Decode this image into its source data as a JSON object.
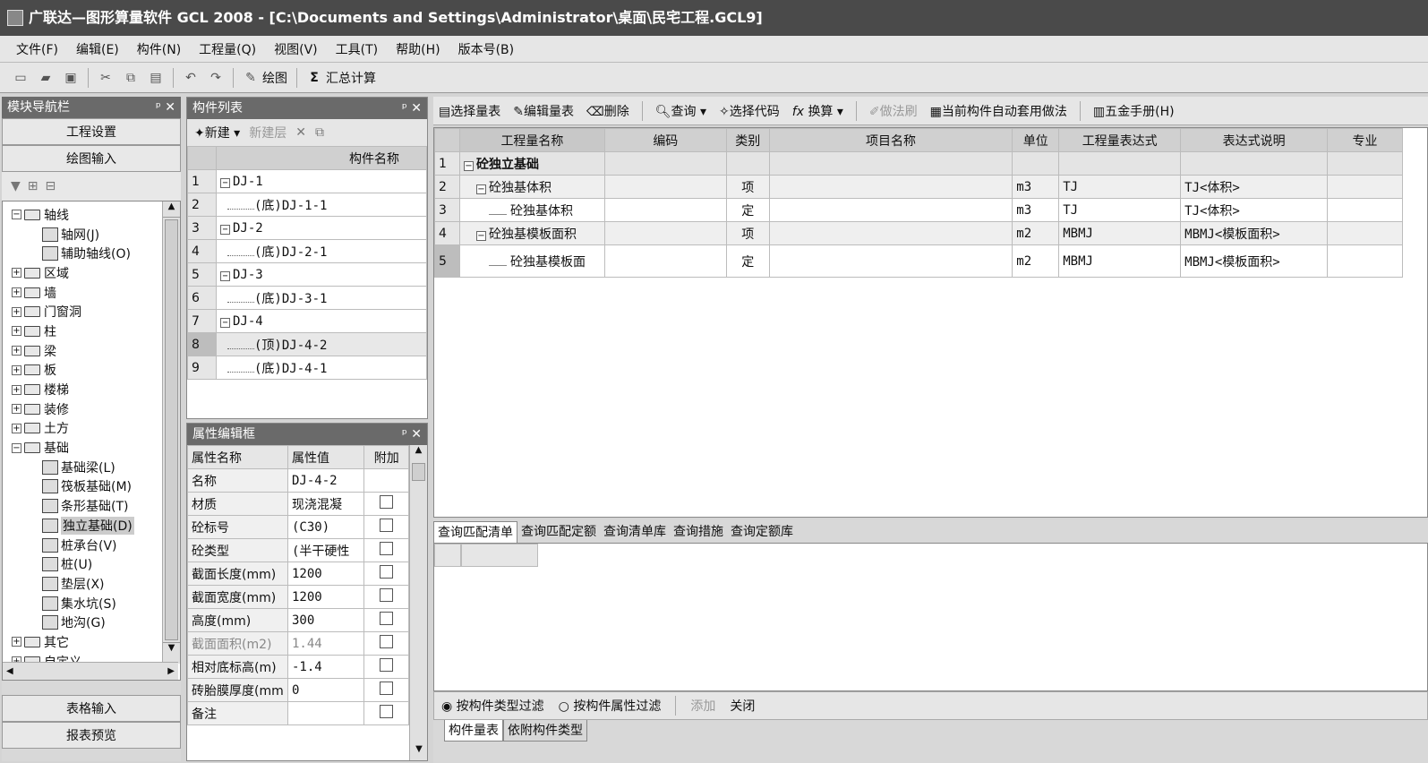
{
  "window": {
    "title": "广联达—图形算量软件 GCL 2008 - [C:\\Documents and Settings\\Administrator\\桌面\\民宅工程.GCL9]"
  },
  "menu": [
    "文件(F)",
    "编辑(E)",
    "构件(N)",
    "工程量(Q)",
    "视图(V)",
    "工具(T)",
    "帮助(H)",
    "版本号(B)"
  ],
  "toolbar": {
    "draw": "绘图",
    "sum": "汇总计算"
  },
  "nav": {
    "title": "模块导航栏",
    "btn_project": "工程设置",
    "btn_draw": "绘图输入",
    "btn_table": "表格输入",
    "btn_report": "报表预览",
    "tree": [
      {
        "label": "轴线",
        "level": 0,
        "exp": "−",
        "icon": "folder-open"
      },
      {
        "label": "轴网(J)",
        "level": 1,
        "icon": "grid"
      },
      {
        "label": "辅助轴线(O)",
        "level": 1,
        "icon": "axis"
      },
      {
        "label": "区域",
        "level": 0,
        "exp": "+",
        "icon": "folder"
      },
      {
        "label": "墙",
        "level": 0,
        "exp": "+",
        "icon": "folder"
      },
      {
        "label": "门窗洞",
        "level": 0,
        "exp": "+",
        "icon": "folder"
      },
      {
        "label": "柱",
        "level": 0,
        "exp": "+",
        "icon": "folder"
      },
      {
        "label": "梁",
        "level": 0,
        "exp": "+",
        "icon": "folder"
      },
      {
        "label": "板",
        "level": 0,
        "exp": "+",
        "icon": "folder"
      },
      {
        "label": "楼梯",
        "level": 0,
        "exp": "+",
        "icon": "folder"
      },
      {
        "label": "装修",
        "level": 0,
        "exp": "+",
        "icon": "folder"
      },
      {
        "label": "土方",
        "level": 0,
        "exp": "+",
        "icon": "folder"
      },
      {
        "label": "基础",
        "level": 0,
        "exp": "−",
        "icon": "folder-open"
      },
      {
        "label": "基础梁(L)",
        "level": 1,
        "icon": "beam"
      },
      {
        "label": "筏板基础(M)",
        "level": 1,
        "icon": "raft"
      },
      {
        "label": "条形基础(T)",
        "level": 1,
        "icon": "strip"
      },
      {
        "label": "独立基础(D)",
        "level": 1,
        "icon": "isolated",
        "selected": true
      },
      {
        "label": "桩承台(V)",
        "level": 1,
        "icon": "cap"
      },
      {
        "label": "桩(U)",
        "level": 1,
        "icon": "pile"
      },
      {
        "label": "垫层(X)",
        "level": 1,
        "icon": "cushion"
      },
      {
        "label": "集水坑(S)",
        "level": 1,
        "icon": "sump"
      },
      {
        "label": "地沟(G)",
        "level": 1,
        "icon": "trench"
      },
      {
        "label": "其它",
        "level": 0,
        "exp": "+",
        "icon": "folder"
      },
      {
        "label": "自定义",
        "level": 0,
        "exp": "+",
        "icon": "folder"
      }
    ]
  },
  "components": {
    "title": "构件列表",
    "new": "新建",
    "new_layer": "新建层",
    "col": "构件名称",
    "rows": [
      {
        "n": "1",
        "name": "DJ-1",
        "root": true
      },
      {
        "n": "2",
        "name": "(底)DJ-1-1"
      },
      {
        "n": "3",
        "name": "DJ-2",
        "root": true
      },
      {
        "n": "4",
        "name": "(底)DJ-2-1"
      },
      {
        "n": "5",
        "name": "DJ-3",
        "root": true
      },
      {
        "n": "6",
        "name": "(底)DJ-3-1"
      },
      {
        "n": "7",
        "name": "DJ-4",
        "root": true
      },
      {
        "n": "8",
        "name": "(顶)DJ-4-2",
        "selected": true
      },
      {
        "n": "9",
        "name": "(底)DJ-4-1"
      }
    ]
  },
  "props": {
    "title": "属性编辑框",
    "cols": [
      "属性名称",
      "属性值",
      "附加"
    ],
    "rows": [
      {
        "name": "名称",
        "value": "DJ-4-2",
        "chk": false
      },
      {
        "name": "材质",
        "value": "现浇混凝",
        "chk": true
      },
      {
        "name": "砼标号",
        "value": "(C30)",
        "chk": true
      },
      {
        "name": "砼类型",
        "value": "(半干硬性",
        "chk": true
      },
      {
        "name": "截面长度(mm)",
        "value": "1200",
        "chk": true
      },
      {
        "name": "截面宽度(mm)",
        "value": "1200",
        "chk": true
      },
      {
        "name": "高度(mm)",
        "value": "300",
        "chk": true
      },
      {
        "name": "截面面积(m2)",
        "value": "1.44",
        "chk": true,
        "dim": true
      },
      {
        "name": "相对底标高(m)",
        "value": "-1.4",
        "chk": true
      },
      {
        "name": "砖胎膜厚度(mm",
        "value": "0",
        "chk": true
      },
      {
        "name": "备注",
        "value": "",
        "chk": true
      }
    ]
  },
  "qtoolbar": {
    "select": "选择量表",
    "edit": "编辑量表",
    "delete": "删除",
    "query": "查询",
    "select_code": "选择代码",
    "convert": "换算",
    "method": "做法刷",
    "auto": "当前构件自动套用做法",
    "manual": "五金手册(H)"
  },
  "qtable": {
    "cols": [
      "工程量名称",
      "编码",
      "类别",
      "项目名称",
      "单位",
      "工程量表达式",
      "表达式说明",
      "专业"
    ],
    "rows": [
      {
        "n": "1",
        "name": "砼独立基础",
        "code": "",
        "type": "",
        "proj": "",
        "unit": "",
        "expr": "",
        "desc": "",
        "spec": "",
        "level": 0,
        "bold": true
      },
      {
        "n": "2",
        "name": "砼独基体积",
        "code": "",
        "type": "项",
        "proj": "",
        "unit": "m3",
        "expr": "TJ",
        "desc": "TJ<体积>",
        "spec": "",
        "level": 1
      },
      {
        "n": "3",
        "name": "砼独基体积",
        "code": "",
        "type": "定",
        "proj": "",
        "unit": "m3",
        "expr": "TJ",
        "desc": "TJ<体积>",
        "spec": "",
        "level": 2
      },
      {
        "n": "4",
        "name": "砼独基模板面积",
        "code": "",
        "type": "项",
        "proj": "",
        "unit": "m2",
        "expr": "MBMJ",
        "desc": "MBMJ<模板面积>",
        "spec": "",
        "level": 1
      },
      {
        "n": "5",
        "name": "砼独基模板面",
        "code": "",
        "type": "定",
        "proj": "",
        "unit": "m2",
        "expr": "MBMJ",
        "desc": "MBMJ<模板面积>",
        "spec": "",
        "level": 2
      }
    ]
  },
  "bottom_tabs": [
    "查询匹配清单",
    "查询匹配定额",
    "查询清单库",
    "查询措施",
    "查询定额库"
  ],
  "filter": {
    "by_type": "按构件类型过滤",
    "by_attr": "按构件属性过滤",
    "add": "添加",
    "close": "关闭"
  },
  "sheet_tabs": [
    "构件量表",
    "依附构件类型"
  ]
}
